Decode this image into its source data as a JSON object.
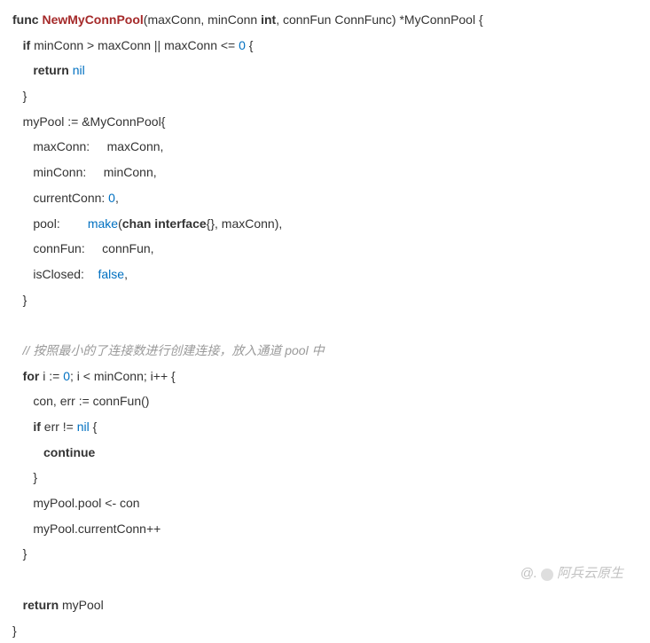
{
  "lines": [
    {
      "indent": 0,
      "tokens": [
        {
          "t": "func ",
          "c": "kw"
        },
        {
          "t": "NewMyConnPool",
          "c": "fn-name"
        },
        {
          "t": "(maxConn, minConn ",
          "c": "plain"
        },
        {
          "t": "int",
          "c": "type"
        },
        {
          "t": ", connFun ConnFunc) *MyConnPool {",
          "c": "plain"
        }
      ]
    },
    {
      "indent": 1,
      "tokens": [
        {
          "t": "if",
          "c": "kw"
        },
        {
          "t": " minConn > maxConn || maxConn <= ",
          "c": "plain"
        },
        {
          "t": "0",
          "c": "lit"
        },
        {
          "t": " {",
          "c": "plain"
        }
      ]
    },
    {
      "indent": 2,
      "tokens": [
        {
          "t": "return ",
          "c": "kw"
        },
        {
          "t": "nil",
          "c": "lit"
        }
      ]
    },
    {
      "indent": 1,
      "tokens": [
        {
          "t": "}",
          "c": "plain"
        }
      ]
    },
    {
      "indent": 1,
      "tokens": [
        {
          "t": "myPool := &MyConnPool{",
          "c": "plain"
        }
      ]
    },
    {
      "indent": 2,
      "tokens": [
        {
          "t": "maxConn:     maxConn,",
          "c": "plain"
        }
      ]
    },
    {
      "indent": 2,
      "tokens": [
        {
          "t": "minConn:     minConn,",
          "c": "plain"
        }
      ]
    },
    {
      "indent": 2,
      "tokens": [
        {
          "t": "currentConn: ",
          "c": "plain"
        },
        {
          "t": "0",
          "c": "lit"
        },
        {
          "t": ",",
          "c": "plain"
        }
      ]
    },
    {
      "indent": 2,
      "tokens": [
        {
          "t": "pool:        ",
          "c": "plain"
        },
        {
          "t": "make",
          "c": "kw-blue"
        },
        {
          "t": "(",
          "c": "plain"
        },
        {
          "t": "chan interface",
          "c": "str-chan"
        },
        {
          "t": "{}, maxConn),",
          "c": "plain"
        }
      ]
    },
    {
      "indent": 2,
      "tokens": [
        {
          "t": "connFun:     connFun,",
          "c": "plain"
        }
      ]
    },
    {
      "indent": 2,
      "tokens": [
        {
          "t": "isClosed:    ",
          "c": "plain"
        },
        {
          "t": "false",
          "c": "lit"
        },
        {
          "t": ",",
          "c": "plain"
        }
      ]
    },
    {
      "indent": 1,
      "tokens": [
        {
          "t": "}",
          "c": "plain"
        }
      ]
    },
    {
      "indent": 0,
      "tokens": [
        {
          "t": " ",
          "c": "plain"
        }
      ]
    },
    {
      "indent": 1,
      "tokens": [
        {
          "t": "// 按照最小的了连接数进行创建连接，放入通道 pool 中",
          "c": "comment"
        }
      ]
    },
    {
      "indent": 1,
      "tokens": [
        {
          "t": "for",
          "c": "kw"
        },
        {
          "t": " i := ",
          "c": "plain"
        },
        {
          "t": "0",
          "c": "lit"
        },
        {
          "t": "; i < minConn; i++ {",
          "c": "plain"
        }
      ]
    },
    {
      "indent": 2,
      "tokens": [
        {
          "t": "con, err := connFun()",
          "c": "plain"
        }
      ]
    },
    {
      "indent": 2,
      "tokens": [
        {
          "t": "if",
          "c": "kw"
        },
        {
          "t": " err != ",
          "c": "plain"
        },
        {
          "t": "nil",
          "c": "lit"
        },
        {
          "t": " {",
          "c": "plain"
        }
      ]
    },
    {
      "indent": 3,
      "tokens": [
        {
          "t": "continue",
          "c": "kw"
        }
      ]
    },
    {
      "indent": 2,
      "tokens": [
        {
          "t": "}",
          "c": "plain"
        }
      ]
    },
    {
      "indent": 2,
      "tokens": [
        {
          "t": "myPool.pool <- con",
          "c": "plain"
        }
      ]
    },
    {
      "indent": 2,
      "tokens": [
        {
          "t": "myPool.currentConn++",
          "c": "plain"
        }
      ]
    },
    {
      "indent": 1,
      "tokens": [
        {
          "t": "}",
          "c": "plain"
        }
      ]
    },
    {
      "indent": 0,
      "tokens": [
        {
          "t": " ",
          "c": "plain"
        }
      ]
    },
    {
      "indent": 1,
      "tokens": [
        {
          "t": "return",
          "c": "kw"
        },
        {
          "t": " myPool",
          "c": "plain"
        }
      ]
    },
    {
      "indent": 0,
      "tokens": [
        {
          "t": "}",
          "c": "plain"
        }
      ]
    }
  ],
  "watermark": {
    "prefix": "@.",
    "text": "阿兵云原生"
  }
}
